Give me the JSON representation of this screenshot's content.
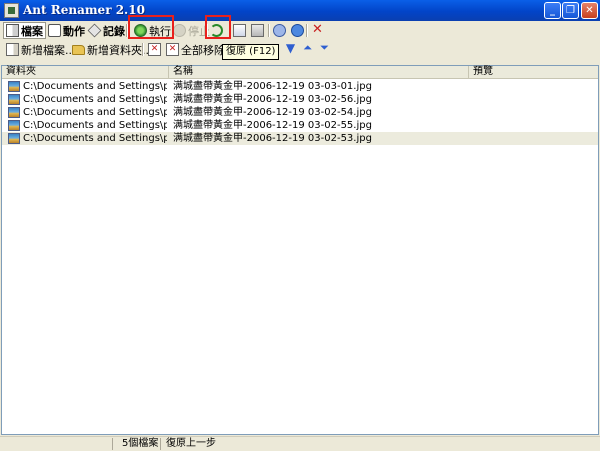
{
  "window": {
    "title": "Ant Renamer 2.10"
  },
  "tabs": {
    "files": "檔案",
    "actions": "動作",
    "log": "記錄"
  },
  "toolbar": {
    "execute": "執行",
    "stop": "停止"
  },
  "toolbar2": {
    "add_files": "新增檔案...",
    "add_folder": "新增資料夾...",
    "remove_all": "全部移除"
  },
  "tooltip": {
    "undo": "復原 (F12)"
  },
  "table": {
    "columns": {
      "folder": "資料夾",
      "name": "名稱",
      "preview": "預覽"
    },
    "rows": [
      {
        "folder": "C:\\Documents and Settings\\pk\\桌面\\...",
        "name": "满城盡帶黃金甲-2006-12-19 03-03-01.jpg"
      },
      {
        "folder": "C:\\Documents and Settings\\pk\\桌面\\...",
        "name": "满城盡帶黃金甲-2006-12-19 03-02-56.jpg"
      },
      {
        "folder": "C:\\Documents and Settings\\pk\\桌面\\...",
        "name": "满城盡帶黃金甲-2006-12-19 03-02-54.jpg"
      },
      {
        "folder": "C:\\Documents and Settings\\pk\\桌面\\...",
        "name": "满城盡帶黃金甲-2006-12-19 03-02-55.jpg"
      },
      {
        "folder": "C:\\Documents and Settings\\pk\\桌面\\...",
        "name": "满城盡帶黃金甲-2006-12-19 03-02-53.jpg"
      }
    ]
  },
  "status": {
    "count": "5個檔案",
    "message": "復原上一步"
  },
  "icons": {
    "app": "app-icon",
    "files_tab": "files-tab-icon",
    "actions_tab": "actions-tab-icon",
    "log_tab": "log-tab-icon",
    "execute": "execute-icon",
    "stop": "stop-icon",
    "undo": "undo-icon",
    "copy": "copy-icon",
    "paste": "paste-icon",
    "help": "help-icon",
    "about": "about-icon",
    "exit": "exit-icon",
    "add_files": "add-files-icon",
    "add_folder": "add-folder-icon",
    "remove": "remove-icon",
    "remove_all": "remove-all-icon",
    "move_top": "move-top-icon",
    "move_up": "move-up-icon",
    "move_down": "move-down-icon",
    "move_bottom": "move-bottom-icon",
    "image_file": "image-file-icon"
  },
  "colors": {
    "title_bar": "#0a5fe8",
    "highlight": "#e8201c",
    "tooltip_bg": "#ffffe1"
  }
}
